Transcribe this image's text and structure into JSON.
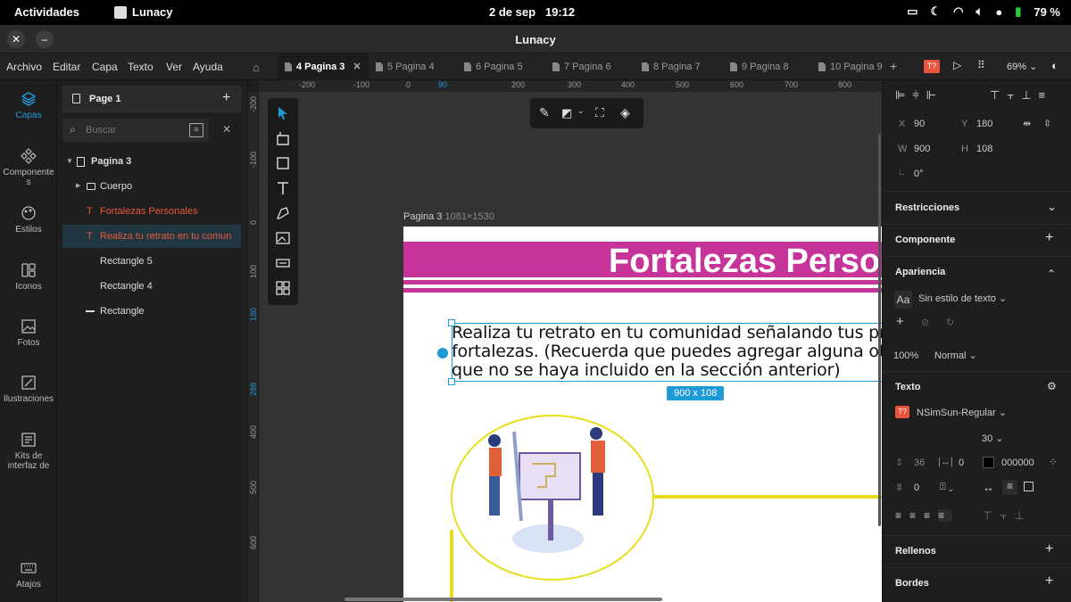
{
  "system_bar": {
    "activities": "Actividades",
    "app_name": "Lunacy",
    "date": "2 de sep",
    "time": "19:12",
    "battery": "79 %"
  },
  "window": {
    "title": "Lunacy"
  },
  "menu": [
    "Archivo",
    "Editar",
    "Capa",
    "Texto",
    "Ver",
    "Ayuda"
  ],
  "tabs": [
    "4 Pagina 3",
    "5 Pagina 4",
    "6 Pagina 5",
    "7 Pagina 6",
    "8 Pagina 7",
    "9 Pagina 8",
    "10 Pagina 9"
  ],
  "zoom": "69%",
  "rail": [
    "Capas",
    "Componentes",
    "Estilos",
    "Iconos",
    "Fotos",
    "Ilustraciones",
    "Kits de interfaz de",
    "Atajos"
  ],
  "layers": {
    "page_title": "Page 1",
    "search_placeholder": "Buscar",
    "items": [
      "Pagina 3",
      "Cuerpo",
      "Fortalezas Personales",
      "Realiza tu retrato en tu comun",
      "Rectangle 5",
      "Rectangle 4",
      "Rectangle"
    ]
  },
  "ruler_top": [
    "-200",
    "-100",
    "0",
    "90",
    "200",
    "300",
    "400",
    "500",
    "600",
    "700",
    "800"
  ],
  "ruler_left": [
    "-200",
    "-100",
    "0",
    "100",
    "180",
    "288",
    "400",
    "500",
    "600"
  ],
  "artboard": {
    "label": "Pagina 3",
    "size": "1081×1530",
    "heading": "Fortalezas Perso",
    "body_line1": "Realiza tu retrato en tu comunidad señalando tus prin",
    "body_line2": "fortalezas. (Recuerda que puedes agregar alguna otra fo",
    "body_line3": "que no se haya incluido en la sección anterior)",
    "size_badge": "900 x 108"
  },
  "props": {
    "x_label": "X",
    "x": "90",
    "y_label": "Y",
    "y": "180",
    "w_label": "W",
    "w": "900",
    "h_label": "H",
    "h": "108",
    "rotation": "0°",
    "restricciones": "Restricciones",
    "componente": "Componente",
    "apariencia": "Apariencia",
    "text_style": "Sin estilo de texto",
    "opacity": "100%",
    "blend": "Normal",
    "texto": "Texto",
    "font": "NSimSun-Regular",
    "font_size": "30",
    "line_height": "36",
    "letter_spacing": "0",
    "color": "000000",
    "paragraph": "0",
    "rellenos": "Rellenos",
    "bordes": "Bordes"
  },
  "colors": {
    "accent": "#1e9bd7",
    "heading_band": "#c6349a",
    "outline": "#e8dd1c",
    "font_icon": "#e9553d"
  }
}
